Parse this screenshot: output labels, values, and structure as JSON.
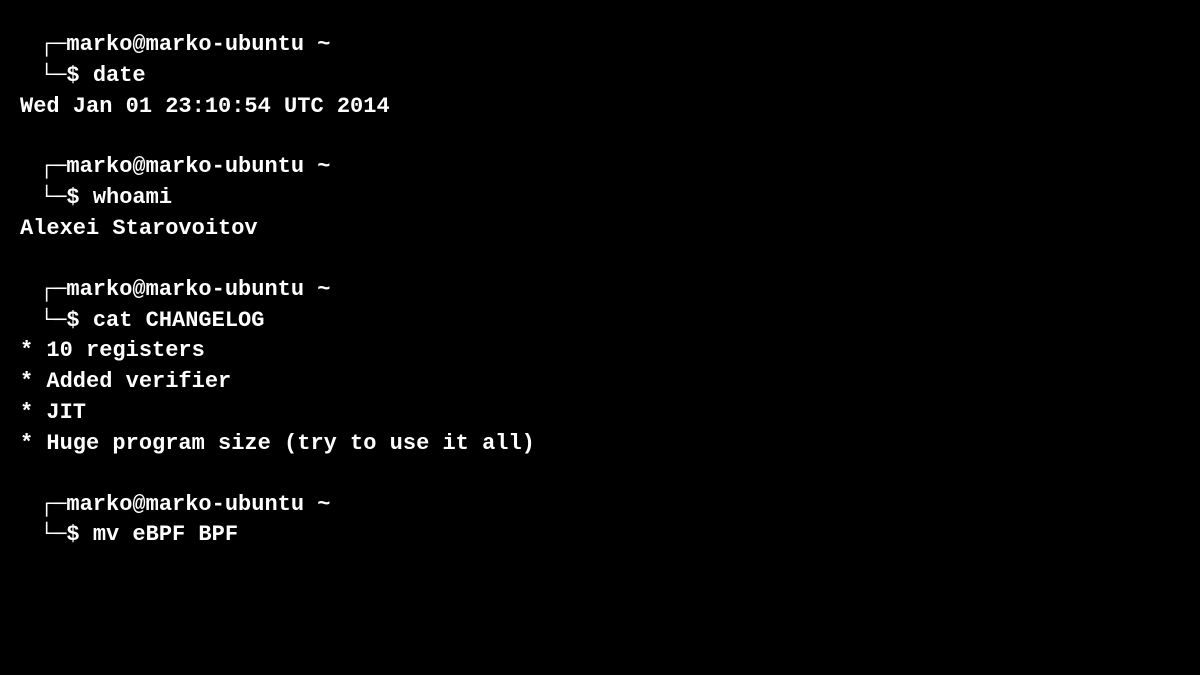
{
  "prompt": {
    "line1_prefix": "┌─",
    "user_host": "marko@marko-ubuntu",
    "path": " ~",
    "line2_prefix": "└─$ "
  },
  "blocks": [
    {
      "command": "date",
      "output": [
        "Wed Jan 01 23:10:54 UTC 2014"
      ]
    },
    {
      "command": "whoami",
      "output": [
        "Alexei Starovoitov"
      ]
    },
    {
      "command": "cat CHANGELOG",
      "output": [
        "* 10 registers",
        "* Added verifier",
        "* JIT",
        "* Huge program size (try to use it all)"
      ]
    },
    {
      "command": "mv eBPF BPF",
      "output": []
    }
  ]
}
